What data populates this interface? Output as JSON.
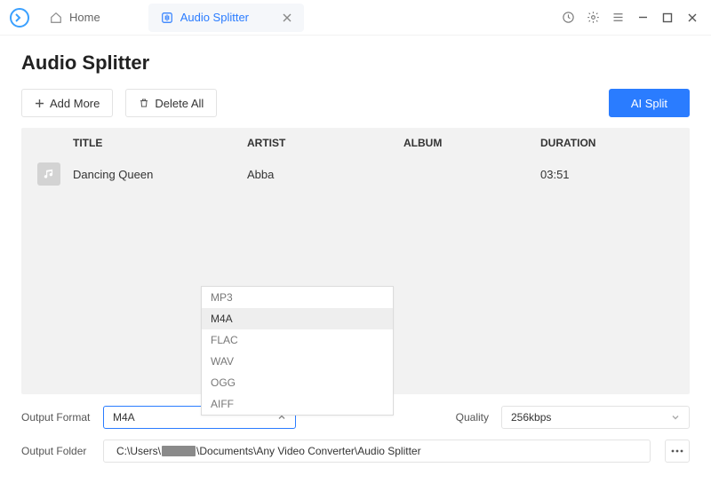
{
  "tabs": {
    "home": {
      "label": "Home"
    },
    "active": {
      "label": "Audio Splitter"
    }
  },
  "page": {
    "title": "Audio Splitter"
  },
  "toolbar": {
    "add_label": "Add More",
    "delete_label": "Delete All",
    "aisplit_label": "AI Split"
  },
  "table": {
    "headers": {
      "title": "TITLE",
      "artist": "ARTIST",
      "album": "ALBUM",
      "duration": "DURATION"
    },
    "rows": [
      {
        "title": "Dancing Queen",
        "artist": "Abba",
        "album": "",
        "duration": "03:51"
      }
    ]
  },
  "output": {
    "format_label": "Output Format",
    "format_value": "M4A",
    "format_options": [
      "MP3",
      "M4A",
      "FLAC",
      "WAV",
      "OGG",
      "AIFF"
    ],
    "quality_label": "Quality",
    "quality_value": "256kbps",
    "folder_label": "Output Folder",
    "folder_prefix": "C:\\Users\\",
    "folder_suffix": "\\Documents\\Any Video Converter\\Audio Splitter"
  }
}
